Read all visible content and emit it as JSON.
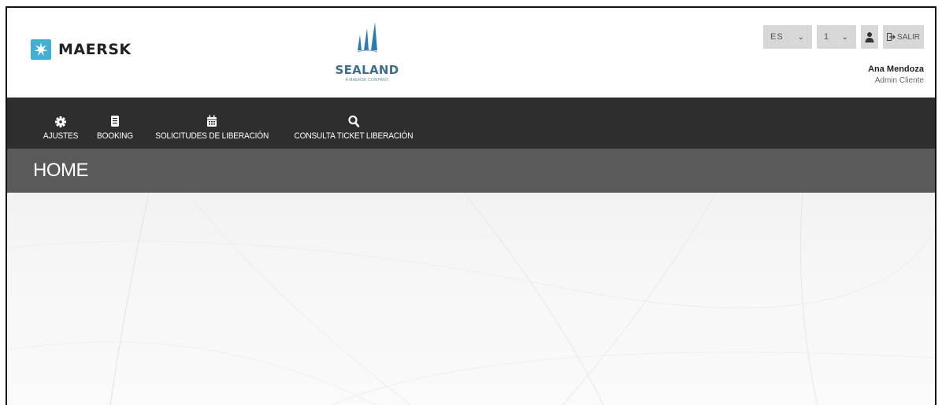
{
  "header": {
    "brand_name": "MAERSK",
    "partner_logo": {
      "name": "SEALAND",
      "tagline": "A MAERSK COMPANY"
    },
    "language_select": {
      "value": "ES"
    },
    "number_select": {
      "value": "1"
    },
    "logout_label": "SALIR",
    "user": {
      "name": "Ana Mendoza",
      "role": "Admin Cliente"
    }
  },
  "nav": {
    "items": [
      {
        "label": "AJUSTES",
        "icon": "gear-icon"
      },
      {
        "label": "BOOKING",
        "icon": "document-icon"
      },
      {
        "label": "SOLICITUDES DE LIBERACIÓN",
        "icon": "calendar-icon"
      },
      {
        "label": "CONSULTA TICKET LIBERACIÓN",
        "icon": "search-icon"
      }
    ]
  },
  "page": {
    "title": "HOME"
  },
  "colors": {
    "nav_bg": "#2e2e2e",
    "title_bg": "#5a5a5a",
    "maersk_blue": "#42b0d5",
    "sealand_blue": "#3c6e8f",
    "control_bg": "#d8d8d8"
  }
}
